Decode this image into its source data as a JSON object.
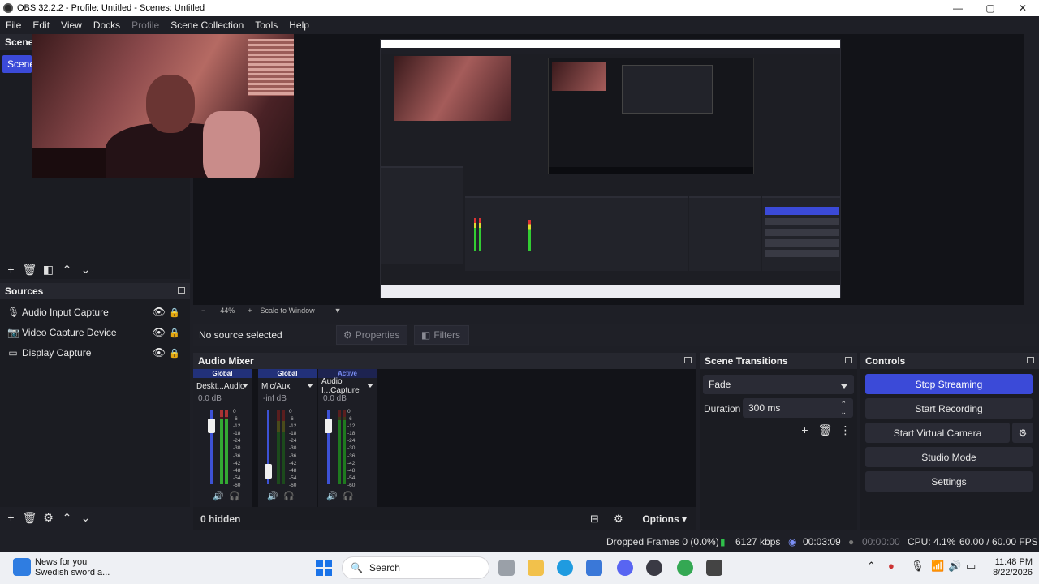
{
  "window": {
    "title": "OBS 32.2.2 - Profile: Untitled - Scenes: Untitled",
    "minimize": "—",
    "maximize": "▢",
    "close": "✕"
  },
  "menu": [
    "File",
    "Edit",
    "View",
    "Docks",
    "Profile",
    "Scene Collection",
    "Tools",
    "Help"
  ],
  "scenes": {
    "header": "Scenes",
    "item": "Scene"
  },
  "zoom": {
    "minus": "−",
    "level": "44%",
    "plus": "+",
    "mode": "Scale to Window"
  },
  "sources": {
    "header": "Sources",
    "items": [
      {
        "label": "Audio Input Capture",
        "icon": "microphone-icon"
      },
      {
        "label": "Video Capture Device",
        "icon": "camera-icon"
      },
      {
        "label": "Display Capture",
        "icon": "monitor-icon"
      }
    ]
  },
  "context": {
    "no_source": "No source selected",
    "properties": "Properties",
    "filters": "Filters"
  },
  "mixer": {
    "header": "Audio Mixer",
    "channels": [
      {
        "tag": "Global",
        "name": "Deskt...Audio",
        "db": "0.0 dB",
        "level": 0.85
      },
      {
        "tag": "Global",
        "name": "Mic/Aux",
        "db": "-inf dB",
        "level": 0.1
      },
      {
        "tag": "Active",
        "name": "Audio I...Capture",
        "db": "0.0 dB",
        "level": 0.85
      }
    ],
    "scale": [
      "0",
      "-6",
      "-12",
      "-18",
      "-24",
      "-30",
      "-36",
      "-42",
      "-48",
      "-54",
      "-60"
    ],
    "hidden": "0 hidden",
    "options": "Options"
  },
  "transitions": {
    "header": "Scene Transitions",
    "transition": "Fade",
    "duration_label": "Duration",
    "duration_value": "300 ms"
  },
  "controls": {
    "header": "Controls",
    "stop_streaming": "Stop Streaming",
    "start_recording": "Start Recording",
    "start_virtual_camera": "Start Virtual Camera",
    "studio_mode": "Studio Mode",
    "settings": "Settings",
    "accent": "#3b4ad8"
  },
  "status": {
    "dropped": "Dropped Frames 0 (0.0%)",
    "bitrate": "6127 kbps",
    "stream_time": "00:03:09",
    "rec_time": "00:00:00",
    "cpu": "CPU: 4.1%",
    "fps": "60.00 / 60.00 FPS"
  },
  "taskbar": {
    "news_title": "News for you",
    "news_sub": "Swedish sword a...",
    "search": "Search",
    "time": "11:48 PM",
    "date": "8/22/2026"
  }
}
